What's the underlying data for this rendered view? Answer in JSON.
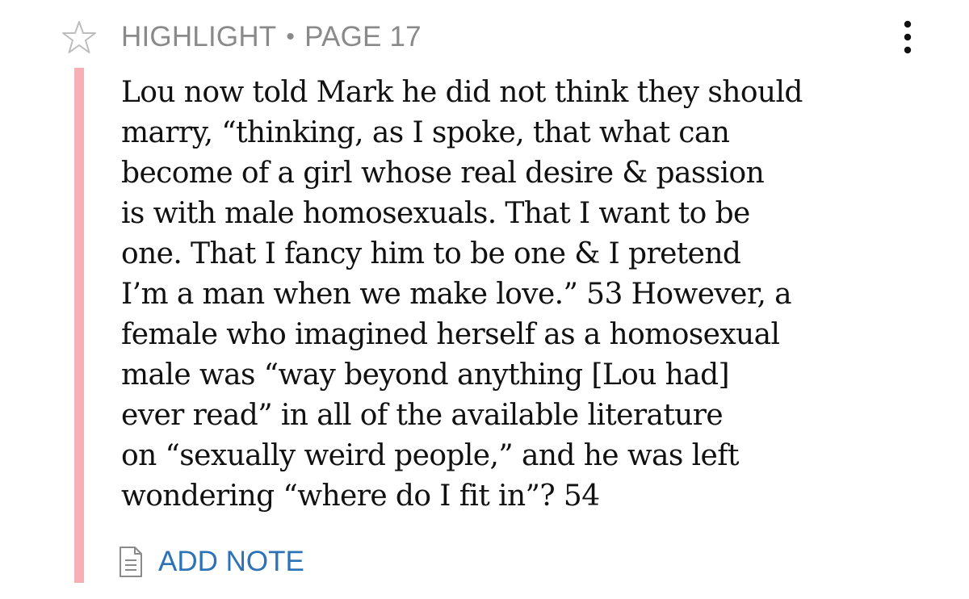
{
  "header": {
    "type_label": "HIGHLIGHT",
    "separator": "•",
    "page_label": "PAGE 17"
  },
  "icons": {
    "star": "star-outline-icon",
    "menu": "more-vertical-icon",
    "note": "note-document-icon"
  },
  "highlight": {
    "color": "#f7aeb4",
    "lines": [
      "Lou now told Mark he did not think they should",
      "marry, “thinking, as I spoke, that what can",
      "become of a girl whose real desire & passion",
      "is with male homosexuals. That I want to be",
      "one. That I fancy him to be one & I pretend",
      "I’m a man when we make love.” 53 However, a",
      "female who imagined herself as a homosexual",
      "male was “way beyond anything [Lou had]",
      "ever read” in all of the available literature",
      "on “sexually weird people,” and he was left",
      "wondering “where do I fit in”? 54"
    ]
  },
  "actions": {
    "add_note_label": "ADD NOTE",
    "accent_color": "#2c72b6"
  }
}
